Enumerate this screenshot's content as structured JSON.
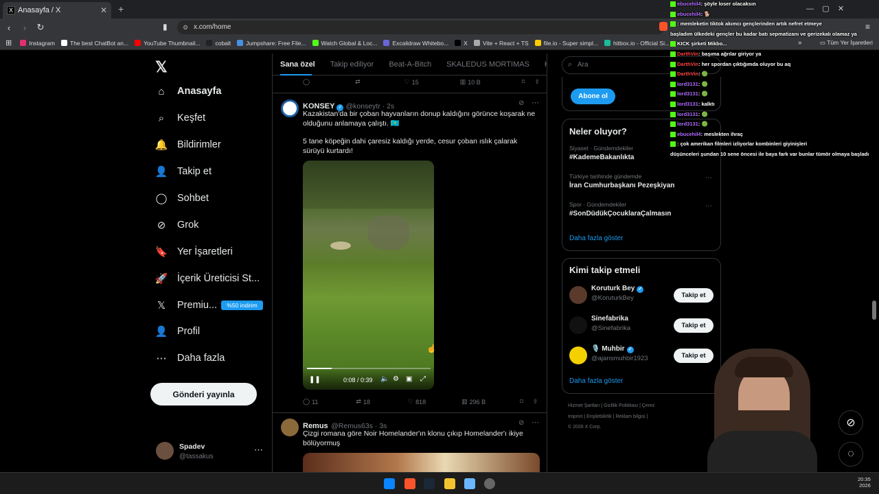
{
  "browser": {
    "tab_title": "Anasayfa / X",
    "tab_favicon": "X",
    "url": "x.com/home",
    "bookmarks": [
      {
        "label": "Instagram",
        "color": "#e1306c"
      },
      {
        "label": "The best ChatBot an...",
        "color": "#ffffff"
      },
      {
        "label": "YouTube Thumbnail...",
        "color": "#ff0000"
      },
      {
        "label": "cobalt",
        "color": "#222222"
      },
      {
        "label": "Jumpshare: Free File...",
        "color": "#4a90e2"
      },
      {
        "label": "Watch Global & Loc...",
        "color": "#53fc18"
      },
      {
        "label": "Excalidraw Whitebo...",
        "color": "#6965db"
      },
      {
        "label": "X",
        "color": "#000000"
      },
      {
        "label": "Vite + React + TS",
        "color": "#aaaaaa"
      },
      {
        "label": "file.io - Super simpl...",
        "color": "#ffcc00"
      },
      {
        "label": "hitbox.io - Official Si...",
        "color": "#1abc9c"
      }
    ],
    "all_bookmarks": "Tüm Yer İşaretleri"
  },
  "nav": {
    "items": [
      {
        "label": "Anasayfa",
        "icon": "home-icon",
        "glyph": "⌂"
      },
      {
        "label": "Keşfet",
        "icon": "search-icon",
        "glyph": "⌕"
      },
      {
        "label": "Bildirimler",
        "icon": "bell-icon",
        "glyph": "🔔"
      },
      {
        "label": "Takip et",
        "icon": "add-user-icon",
        "glyph": "👤"
      },
      {
        "label": "Sohbet",
        "icon": "chat-icon",
        "glyph": "◯"
      },
      {
        "label": "Grok",
        "icon": "grok-icon",
        "glyph": "⊘"
      },
      {
        "label": "Yer İşaretleri",
        "icon": "bookmark-icon",
        "glyph": "🔖"
      },
      {
        "label": "İçerik Üreticisi St...",
        "icon": "rocket-icon",
        "glyph": "🚀"
      },
      {
        "label": "Premiu...",
        "icon": "x-premium-icon",
        "glyph": "𝕏"
      },
      {
        "label": "Profil",
        "icon": "profile-icon",
        "glyph": "👤"
      },
      {
        "label": "Daha fazla",
        "icon": "more-icon",
        "glyph": "⋯"
      }
    ],
    "premium_badge": "%50 indirim",
    "post_button": "Gönderi yayınla",
    "user_name": "Spadev",
    "user_handle": "@tassakus"
  },
  "feed": {
    "tabs": [
      "Sana özel",
      "Takip ediliyor",
      "Beat-A-Bitch",
      "SKALEDUS MORTIMAS",
      "Kend"
    ],
    "prev_actions": {
      "retweets": "",
      "likes": "15",
      "views": "10 B"
    },
    "tweet1": {
      "name": "KONSEY",
      "handle": "@konseytr · 2s",
      "text1": "Kazakistan'da bir çoban hayvanların donup kaldığını görünce koşarak ne olduğunu anlamaya çalıştı. 🇰🇿",
      "text2": "5 tane köpeğin dahi çaresiz kaldığı yerde, cesur çoban ıslık çalarak sürüyü kurtardı!",
      "video_time": "0:08 / 0:39",
      "video_progress": 0.2,
      "replies": "11",
      "retweets": "18",
      "likes": "818",
      "views": "296 B"
    },
    "tweet2": {
      "name": "Remus",
      "handle": "@Remus63s · 3s",
      "text": "Çizgi romana göre Noir Homelander'ın klonu çıkıp Homelander'ı ikiye bölüyormuş"
    }
  },
  "right": {
    "search_placeholder": "Ara",
    "subscribe_button": "Abone ol",
    "trends_title": "Neler oluyor?",
    "trends": [
      {
        "category": "Siyaset · Gündemdekiler",
        "name": "#KademeBakanlıkta"
      },
      {
        "category": "Türkiye tarihinde gündemde",
        "name": "İran Cumhurbaşkanı Pezeşkiyan"
      },
      {
        "category": "Spor · Gündemdekiler",
        "name": "#SonDüdükÇocuklaraÇalmasın"
      }
    ],
    "show_more": "Daha fazla göster",
    "who_to_follow_title": "Kimi takip etmeli",
    "follow": [
      {
        "name": "Koruturk Bey",
        "handle": "@KoruturkBey",
        "verified": true,
        "color": "#5a3a2a"
      },
      {
        "name": "Sinefabrika",
        "handle": "@Sinefabrika",
        "verified": false,
        "color": "#111111"
      },
      {
        "name": "🎙️ Muhbir",
        "handle": "@ajansmuhbir1923",
        "verified": true,
        "color": "#f5d000"
      }
    ],
    "follow_label": "Takip et",
    "footer1": "Hizmet Şartları   |   Gizlilik Politikası   |   Çerez",
    "footer2": "Imprint   |   Erişilebilirlik   |   Reklam bilgisi   |",
    "footer3": "© 2026 X Corp."
  },
  "chat": [
    {
      "user": "ebucehil4",
      "color": "#b06cff",
      "msg": ": şöyle loser olacaksın"
    },
    {
      "user": "ebucehil4",
      "color": "#b06cff",
      "msg": ": 🐕"
    },
    {
      "user": "",
      "color": "#ff4040",
      "msg": ": memleketin tiktok akımcı gençlerinden artık nefret etmeye"
    },
    {
      "user": "",
      "color": "#ffffff",
      "msg": "başladım ülkedeki gençler bu kadar batı sepmatizanı ve gerizekalı olamaz ya"
    },
    {
      "user": "KICK",
      "color": "#ffffff",
      "msg": " şirketi Mikbo..."
    },
    {
      "user": "DarthVin",
      "color": "#ff4040",
      "msg": ": başıma ağrılar giriyor ya"
    },
    {
      "user": "DarthVin",
      "color": "#ff4040",
      "msg": ": her spordan çıktığımda oluyor bu aq"
    },
    {
      "user": "DarthVin",
      "color": "#ff4040",
      "msg": ": 🟢"
    },
    {
      "user": "lord3131",
      "color": "#b06cff",
      "msg": ": 🟢"
    },
    {
      "user": "lord3131",
      "color": "#b06cff",
      "msg": ": 🟢"
    },
    {
      "user": "lord3131",
      "color": "#b06cff",
      "msg": ": kalktı"
    },
    {
      "user": "lord3131",
      "color": "#b06cff",
      "msg": ": 🟢"
    },
    {
      "user": "lord3131",
      "color": "#b06cff",
      "msg": ": 🟢"
    },
    {
      "user": "ebucehil4",
      "color": "#b06cff",
      "msg": ": meslekten ihraç"
    },
    {
      "user": "",
      "color": "#ff4040",
      "msg": ": çok amerikan filmleri izliyorlar kombinleri giyinişleri"
    },
    {
      "user": "",
      "color": "#ffffff",
      "msg": "düşünceleri şundan 10 sene öncesi ile baya fark var bunlar tümör olmaya başladı"
    }
  ],
  "taskbar": {
    "time": "20:35",
    "date": "2026"
  }
}
